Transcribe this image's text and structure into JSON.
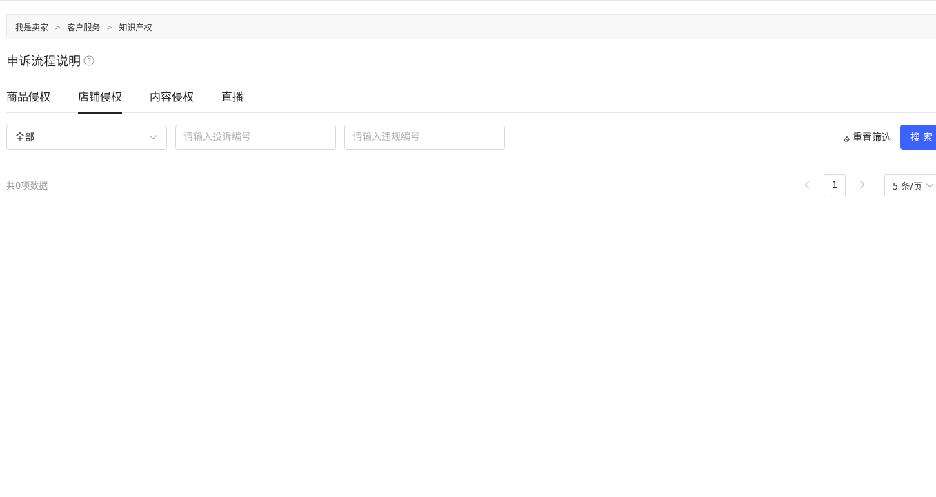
{
  "breadcrumb": {
    "items": [
      "我是卖家",
      "客户服务",
      "知识产权"
    ],
    "separator": ">"
  },
  "page": {
    "title": "申诉流程说明",
    "help_icon": "question-circle-icon"
  },
  "tabs": [
    {
      "label": "商品侵权",
      "active": false
    },
    {
      "label": "店铺侵权",
      "active": true
    },
    {
      "label": "内容侵权",
      "active": false
    },
    {
      "label": "直播",
      "active": false
    }
  ],
  "filters": {
    "type_select": {
      "value": "全部"
    },
    "complaint_no": {
      "placeholder": "请输入投诉编号",
      "value": ""
    },
    "violation_no": {
      "placeholder": "请输入违规编号",
      "value": ""
    },
    "reset_label": "重置筛选",
    "search_label": "搜索"
  },
  "results": {
    "total_text": "共0项数据"
  },
  "pagination": {
    "current_page": "1",
    "page_size": "5 条/页"
  },
  "colors": {
    "primary": "#3d63ff",
    "border": "#d9d9d9",
    "muted_text": "#999999"
  }
}
